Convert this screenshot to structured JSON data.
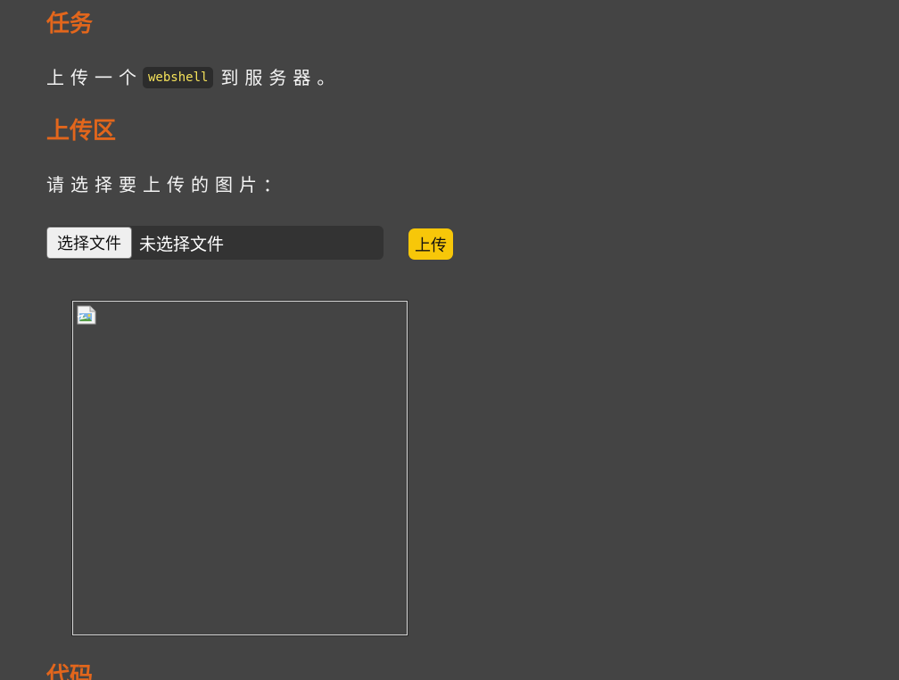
{
  "sections": {
    "task": {
      "heading": "任务",
      "text_before": "上传一个",
      "code": "webshell",
      "text_after": "到服务器。"
    },
    "upload": {
      "heading": "上传区",
      "prompt": "请选择要上传的图片：",
      "choose_file_label": "选择文件",
      "no_file_label": "未选择文件",
      "upload_button_label": "上传"
    },
    "code": {
      "heading": "代码"
    }
  },
  "preview": {
    "icon": "broken-image-icon"
  },
  "colors": {
    "background": "#444444",
    "heading": "#e2661c",
    "code_text": "#f5e25a",
    "upload_button": "#f7c709"
  }
}
